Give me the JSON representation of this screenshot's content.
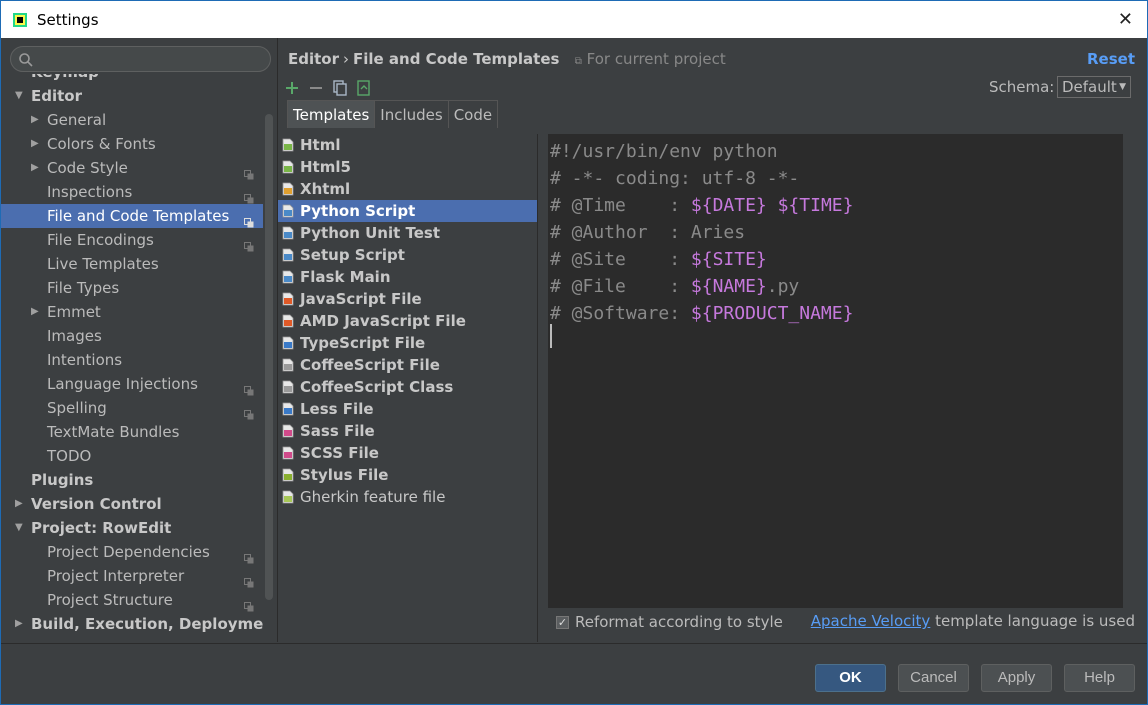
{
  "window": {
    "title": "Settings"
  },
  "search": {
    "placeholder": ""
  },
  "tree": [
    {
      "label": "Keymap",
      "level": 0,
      "bold": true,
      "clipped": true
    },
    {
      "label": "Editor",
      "level": 0,
      "bold": true,
      "arrow": "down"
    },
    {
      "label": "General",
      "level": 1,
      "arrow": "right"
    },
    {
      "label": "Colors & Fonts",
      "level": 1,
      "arrow": "right"
    },
    {
      "label": "Code Style",
      "level": 1,
      "arrow": "right",
      "copy": true
    },
    {
      "label": "Inspections",
      "level": 1,
      "copy": true
    },
    {
      "label": "File and Code Templates",
      "level": 1,
      "copy": true,
      "selected": true
    },
    {
      "label": "File Encodings",
      "level": 1,
      "copy": true
    },
    {
      "label": "Live Templates",
      "level": 1
    },
    {
      "label": "File Types",
      "level": 1
    },
    {
      "label": "Emmet",
      "level": 1,
      "arrow": "right"
    },
    {
      "label": "Images",
      "level": 1
    },
    {
      "label": "Intentions",
      "level": 1
    },
    {
      "label": "Language Injections",
      "level": 1,
      "copy": true
    },
    {
      "label": "Spelling",
      "level": 1,
      "copy": true
    },
    {
      "label": "TextMate Bundles",
      "level": 1
    },
    {
      "label": "TODO",
      "level": 1
    },
    {
      "label": "Plugins",
      "level": 0,
      "bold": true
    },
    {
      "label": "Version Control",
      "level": 0,
      "bold": true,
      "arrow": "right"
    },
    {
      "label": "Project: RowEdit",
      "level": 0,
      "bold": true,
      "arrow": "down"
    },
    {
      "label": "Project Dependencies",
      "level": 1,
      "copy": true
    },
    {
      "label": "Project Interpreter",
      "level": 1,
      "copy": true
    },
    {
      "label": "Project Structure",
      "level": 1,
      "copy": true
    },
    {
      "label": "Build, Execution, Deployment",
      "level": 0,
      "bold": true,
      "arrow": "right"
    }
  ],
  "breadcrumb": {
    "part1": "Editor",
    "sep": "›",
    "part2": "File and Code Templates",
    "scope": "For current project"
  },
  "reset_label": "Reset",
  "schema": {
    "label": "Schema:",
    "value": "Default"
  },
  "tabs": [
    {
      "label": "Templates",
      "active": true
    },
    {
      "label": "Includes"
    },
    {
      "label": "Code"
    }
  ],
  "templates": [
    {
      "label": "Html",
      "icon": "html-file-icon",
      "color": "#7ab648"
    },
    {
      "label": "Html5",
      "icon": "html5-file-icon",
      "color": "#7ab648"
    },
    {
      "label": "Xhtml",
      "icon": "xhtml-file-icon",
      "color": "#e0a030"
    },
    {
      "label": "Python Script",
      "icon": "python-file-icon",
      "color": "#4a8ac8",
      "selected": true
    },
    {
      "label": "Python Unit Test",
      "icon": "python-test-file-icon",
      "color": "#4a8ac8"
    },
    {
      "label": "Setup Script",
      "icon": "python-setup-file-icon",
      "color": "#4a8ac8"
    },
    {
      "label": "Flask Main",
      "icon": "flask-file-icon",
      "color": "#4a8ac8"
    },
    {
      "label": "JavaScript File",
      "icon": "javascript-file-icon",
      "color": "#e05a28"
    },
    {
      "label": "AMD JavaScript File",
      "icon": "amd-javascript-file-icon",
      "color": "#e05a28"
    },
    {
      "label": "TypeScript File",
      "icon": "typescript-file-icon",
      "color": "#3a7ac8"
    },
    {
      "label": "CoffeeScript File",
      "icon": "coffeescript-file-icon",
      "color": "#9a9a9a"
    },
    {
      "label": "CoffeeScript Class",
      "icon": "coffeescript-class-icon",
      "color": "#9a9a9a"
    },
    {
      "label": "Less File",
      "icon": "less-file-icon",
      "color": "#3a7ac8"
    },
    {
      "label": "Sass File",
      "icon": "sass-file-icon",
      "color": "#d04a8a"
    },
    {
      "label": "SCSS File",
      "icon": "scss-file-icon",
      "color": "#d04a8a"
    },
    {
      "label": "Stylus File",
      "icon": "stylus-file-icon",
      "color": "#8ab030"
    },
    {
      "label": "Gherkin feature file",
      "icon": "gherkin-file-icon",
      "color": "#a8c858",
      "normal": true
    }
  ],
  "code": [
    [
      {
        "t": "#!/usr/bin/env python",
        "c": "plain"
      }
    ],
    [
      {
        "t": "# -*- coding: utf-8 -*-",
        "c": "plain"
      }
    ],
    [
      {
        "t": "# @Time    : ",
        "c": "plain"
      },
      {
        "t": "${DATE}",
        "c": "var"
      },
      {
        "t": " ",
        "c": "plain"
      },
      {
        "t": "${TIME}",
        "c": "var"
      }
    ],
    [
      {
        "t": "# @Author  : Aries",
        "c": "plain"
      }
    ],
    [
      {
        "t": "# @Site    : ",
        "c": "plain"
      },
      {
        "t": "${SITE}",
        "c": "var"
      }
    ],
    [
      {
        "t": "# @File    : ",
        "c": "plain"
      },
      {
        "t": "${NAME}",
        "c": "var"
      },
      {
        "t": ".py",
        "c": "plain"
      }
    ],
    [
      {
        "t": "# @Software: ",
        "c": "plain"
      },
      {
        "t": "${PRODUCT_NAME}",
        "c": "var"
      }
    ]
  ],
  "reformat": {
    "label": "Reformat according to style",
    "checked": true
  },
  "velocity": {
    "link": "Apache Velocity",
    "suffix": " template language is used"
  },
  "buttons": {
    "ok": "OK",
    "cancel": "Cancel",
    "apply": "Apply",
    "help": "Help"
  },
  "colors": {
    "selection": "#4b6eaf",
    "link": "#589df6",
    "template_var": "#c679dd"
  }
}
